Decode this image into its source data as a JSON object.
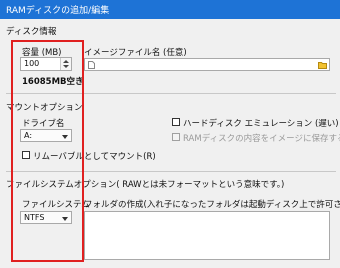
{
  "window": {
    "title": "RAMディスクの追加/編集"
  },
  "disk_info": {
    "section_label": "ディスク情報",
    "capacity_label": "容量 (MB)",
    "capacity_value": "100",
    "free_text": "16085MB空き"
  },
  "image_file": {
    "label": "イメージファイル名 (任意)",
    "value": "",
    "file_icon": "document-icon",
    "browse_icon": "folder-icon"
  },
  "mount": {
    "section_label": "マウントオプション",
    "drive_label": "ドライブ名",
    "drive_value": "A:",
    "removable_label": "リムーバブルとしてマウント(R)",
    "removable_checked": false,
    "hdd_emulation_label": "ハードディスク エミュレーション (遅い)",
    "hdd_emulation_checked": false,
    "save_to_image_label": "RAMディスクの内容をイメージに保存する(S)",
    "save_to_image_checked": false
  },
  "filesystem": {
    "section_label": "ファイルシステムオプション( RAWとは未フォーマットという意味です。)",
    "fs_label": "ファイルシステム",
    "fs_value": "NTFS",
    "folders_label": "フォルダの作成(入れ子になったフォルダは起動ディスク上で許可されていません)",
    "folders_value": ""
  },
  "colors": {
    "titlebar": "#1e73d6",
    "highlight_box": "#e02020"
  }
}
